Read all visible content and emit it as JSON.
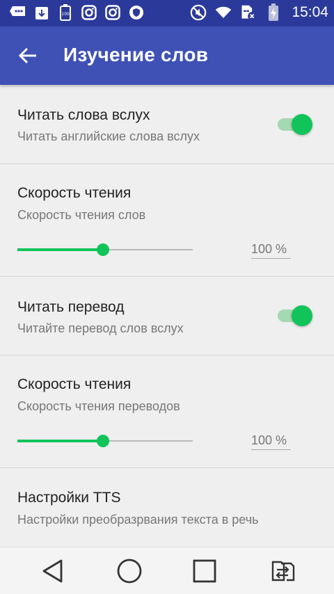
{
  "status_bar": {
    "time": "15:04",
    "left_icons": [
      "message-icon",
      "download-icon",
      "battery-100-icon",
      "instagram-icon",
      "instagram-icon",
      "shield-icon"
    ],
    "right_icons": [
      "no-sound-icon",
      "wifi-icon",
      "sim-off-icon",
      "battery-charging-icon"
    ],
    "battery_label": "100"
  },
  "appbar": {
    "title": "Изучение слов",
    "background": "#3f51b5"
  },
  "settings": [
    {
      "title": "Читать слова вслух",
      "subtitle": "Читать английские слова вслух",
      "switch_on": true
    },
    {
      "title": "Скорость чтения",
      "subtitle": "Скорость чтения слов",
      "slider_fraction": 0.49,
      "value": "100 %"
    },
    {
      "title": "Читать перевод",
      "subtitle": "Читайте перевод слов вслух",
      "switch_on": true
    },
    {
      "title": "Скорость чтения",
      "subtitle": "Скорость чтения переводов",
      "slider_fraction": 0.49,
      "value": "100 %"
    },
    {
      "title": "Настройки TTS",
      "subtitle": "Настройки преобразрвания текста в речь"
    }
  ],
  "accent_color": "#11c45a",
  "navbar": {
    "buttons": [
      "back-nav-icon",
      "home-nav-icon",
      "recents-nav-icon",
      "switch-sim-icon"
    ]
  }
}
